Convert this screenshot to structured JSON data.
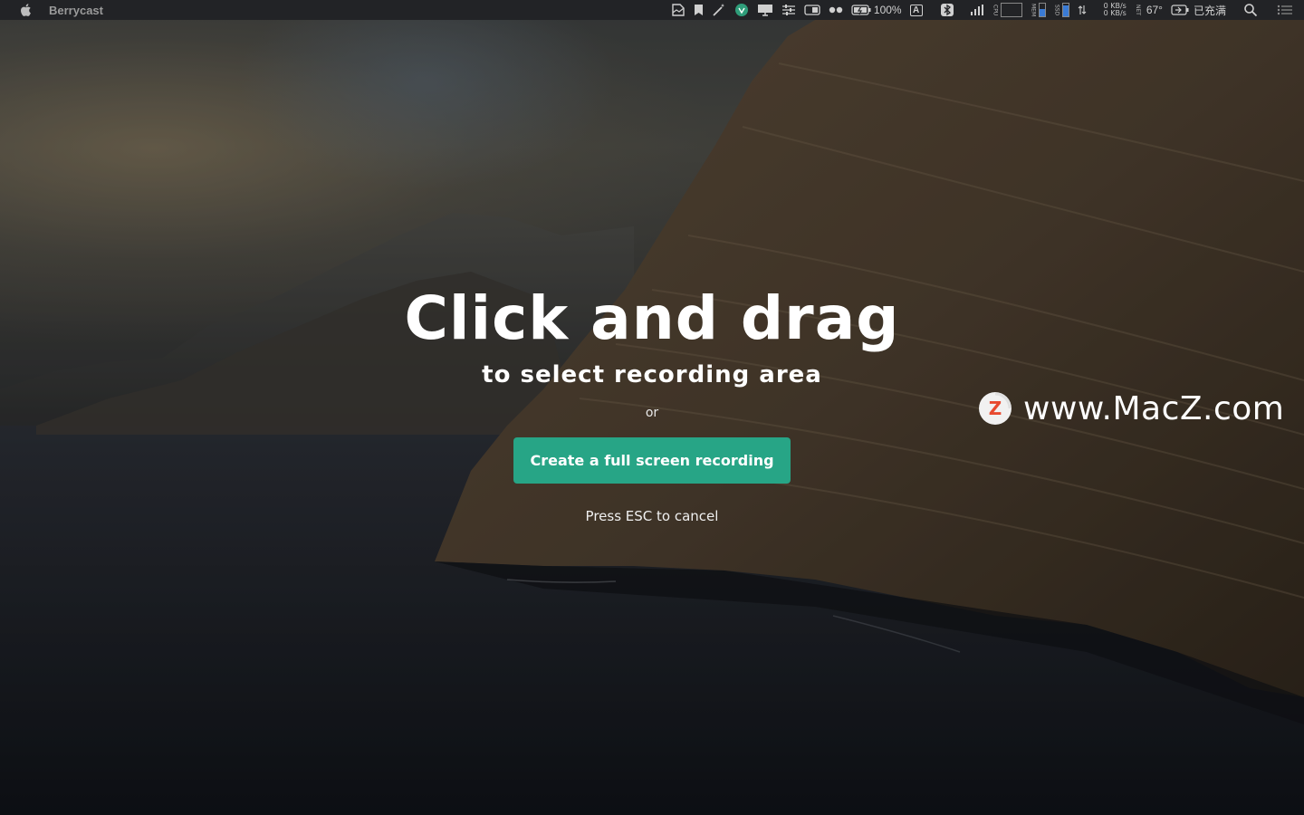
{
  "menubar": {
    "app_name": "Berrycast",
    "battery_percent": "100%",
    "input_source": "A",
    "net_up": "0 KB/s",
    "net_down": "0 KB/s",
    "temperature": "67°",
    "charge_status": "已充满",
    "icons": [
      "apple-icon",
      "page-icon",
      "bookmark-icon",
      "magic-wand-icon",
      "vpn-shield-icon",
      "display-icon",
      "sliders-icon",
      "toggle-icon",
      "dots-icon",
      "battery-icon",
      "input-source-icon",
      "bluetooth-icon",
      "signal-icon",
      "cpu-graph-icon",
      "memory-graph-icon",
      "ssd-graph-icon",
      "network-arrows-icon",
      "battery-status-icon",
      "search-icon",
      "control-center-icon"
    ],
    "mini_labels": {
      "cpu": "CPU",
      "mem": "MEM",
      "ssd": "SSD",
      "net": "NET"
    }
  },
  "overlay": {
    "headline": "Click and drag",
    "subline": "to select recording area",
    "or": "or",
    "fullscreen_button": "Create a full screen recording",
    "esc_hint": "Press ESC to cancel",
    "button_color": "#27a586"
  },
  "watermark": {
    "text": "www.MacZ.com",
    "logo_letter": "Z"
  }
}
